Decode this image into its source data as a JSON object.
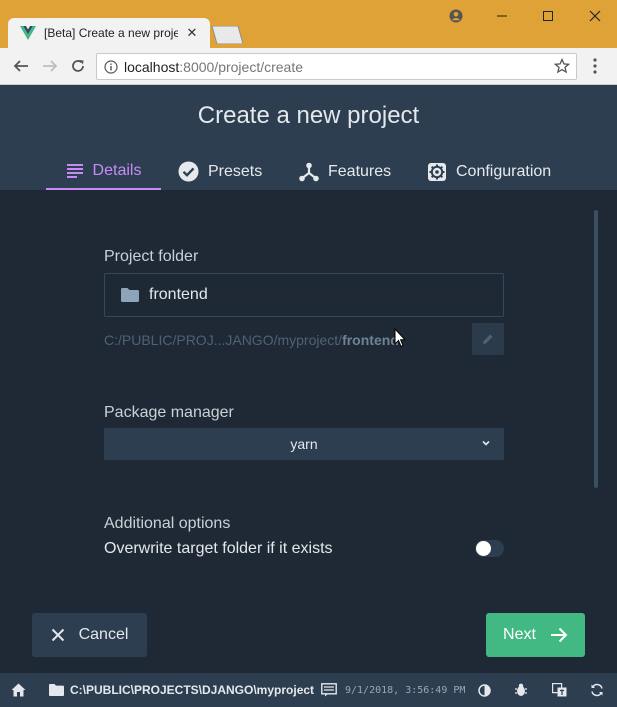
{
  "browser": {
    "tab_title": "[Beta] Create a new project",
    "url_host": "localhost",
    "url_path": ":8000/project/create"
  },
  "header": {
    "title": "Create a new project",
    "tabs": [
      {
        "label": "Details",
        "icon": "details-icon",
        "active": true
      },
      {
        "label": "Presets",
        "icon": "check-circle-icon",
        "active": false
      },
      {
        "label": "Features",
        "icon": "features-icon",
        "active": false
      },
      {
        "label": "Configuration",
        "icon": "gear-icon",
        "active": false
      }
    ]
  },
  "form": {
    "folder_label": "Project folder",
    "folder_value": "frontend",
    "path_prefix": "C:/PUBLIC/PROJ...JANGO/myproject/",
    "path_folder": "frontend",
    "package_label": "Package manager",
    "package_value": "yarn",
    "additional_label": "Additional options",
    "overwrite_label": "Overwrite target folder if it exists",
    "overwrite_enabled": false
  },
  "actions": {
    "cancel_label": "Cancel",
    "next_label": "Next"
  },
  "statusbar": {
    "cwd": "C:\\PUBLIC\\PROJECTS\\DJANGO\\myproject",
    "timestamp": "9/1/2018, 3:56:49 PM"
  },
  "colors": {
    "accent": "#c88bf6",
    "primary": "#42b983",
    "header_bg": "#2c3e50",
    "content_bg": "#1f2935",
    "chrome": "#dfa237"
  }
}
